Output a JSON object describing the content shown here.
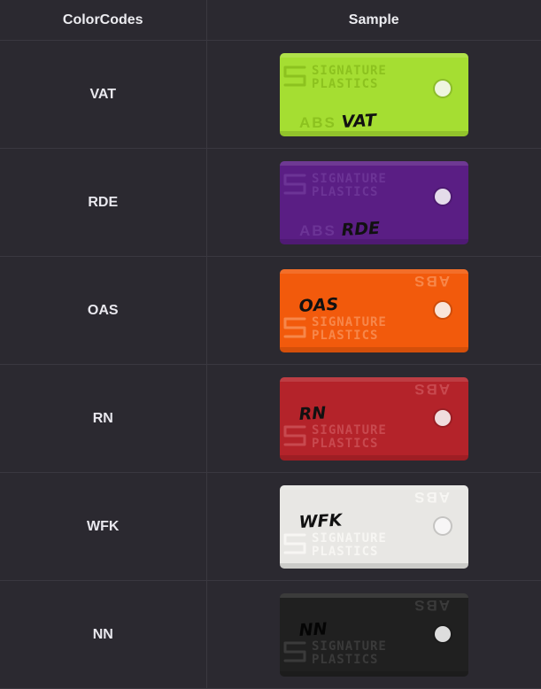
{
  "table": {
    "headers": [
      "ColorCodes",
      "Sample"
    ],
    "rows": [
      {
        "code": "VAT",
        "handwritten": "VAT",
        "color": "#a5de32",
        "ink": "#111111",
        "emboss": "#8cc21f",
        "abs_position": "bottom-left",
        "abs_text": "ABS",
        "brand": [
          "SIGNATURE",
          "PLASTICS"
        ],
        "brand_position": "top"
      },
      {
        "code": "RDE",
        "handwritten": "RDE",
        "color": "#5a1e84",
        "ink": "#111111",
        "emboss": "#6c3496",
        "abs_position": "bottom-left",
        "abs_text": "ABS",
        "brand": [
          "SIGNATURE",
          "PLASTICS"
        ],
        "brand_position": "top"
      },
      {
        "code": "OAS",
        "handwritten": "OAS",
        "color": "#f25a0c",
        "ink": "#111111",
        "emboss": "#f7874a",
        "abs_position": "top-right",
        "abs_text": "ABS",
        "brand": [
          "SIGNATURE",
          "PLASTICS"
        ],
        "brand_position": "bottom"
      },
      {
        "code": "RN",
        "handwritten": "RN",
        "color": "#b4232a",
        "ink": "#111111",
        "emboss": "#c8494f",
        "abs_position": "top-right",
        "abs_text": "ABS",
        "brand": [
          "SIGNATURE",
          "PLASTICS"
        ],
        "brand_position": "bottom"
      },
      {
        "code": "WFK",
        "handwritten": "WFK",
        "color": "#e8e7e4",
        "ink": "#111111",
        "emboss": "#f7f6f3",
        "abs_position": "top-right",
        "abs_text": "ABS",
        "brand": [
          "SIGNATURE",
          "PLASTICS"
        ],
        "brand_position": "bottom"
      },
      {
        "code": "NN",
        "handwritten": "NN",
        "color": "#202020",
        "ink": "#050505",
        "emboss": "#3a3a3a",
        "abs_position": "top-right",
        "abs_text": "ABS",
        "brand": [
          "SIGNATURE",
          "PLASTICS"
        ],
        "brand_position": "bottom"
      }
    ]
  }
}
